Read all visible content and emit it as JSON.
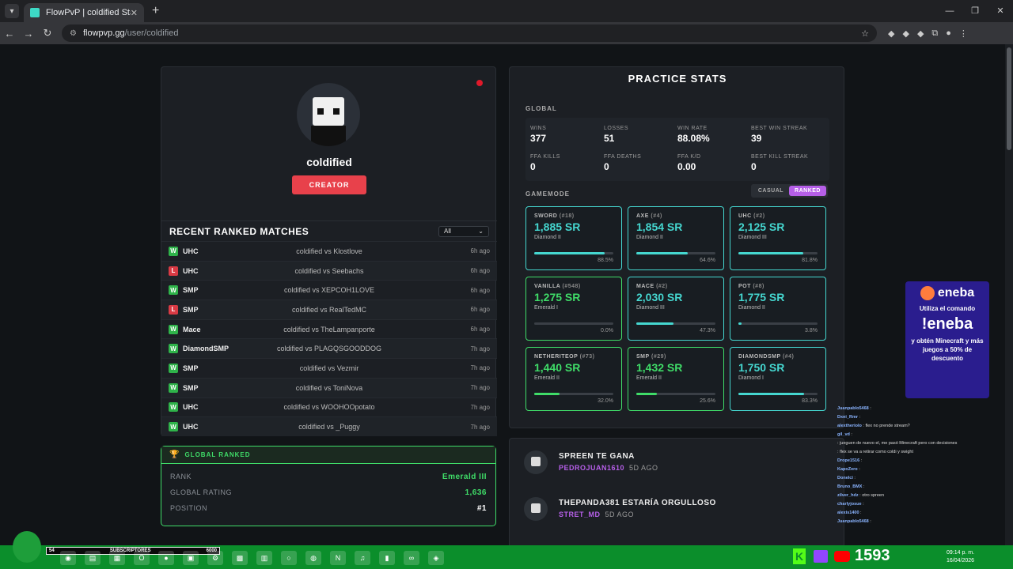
{
  "browser": {
    "tab_title": "FlowPvP | coldified Stats",
    "url_host": "flowpvp.gg",
    "url_path": "/user/coldified"
  },
  "profile": {
    "username": "coldified",
    "role_badge": "CREATOR"
  },
  "recent_matches": {
    "title": "RECENT RANKED MATCHES",
    "filter": "All",
    "rows": [
      {
        "result": "W",
        "mode": "UHC",
        "match": "coldified vs Klostlove",
        "time": "6h ago"
      },
      {
        "result": "L",
        "mode": "UHC",
        "match": "coldified vs Seebachs",
        "time": "6h ago"
      },
      {
        "result": "W",
        "mode": "SMP",
        "match": "coldified vs XEPCOH1LOVE",
        "time": "6h ago"
      },
      {
        "result": "L",
        "mode": "SMP",
        "match": "coldified vs RealTedMC",
        "time": "6h ago"
      },
      {
        "result": "W",
        "mode": "Mace",
        "match": "coldified vs TheLampanporte",
        "time": "6h ago"
      },
      {
        "result": "W",
        "mode": "DiamondSMP",
        "match": "coldified vs PLAGQSGOODDOG",
        "time": "7h ago"
      },
      {
        "result": "W",
        "mode": "SMP",
        "match": "coldified vs Vezmir",
        "time": "7h ago"
      },
      {
        "result": "W",
        "mode": "SMP",
        "match": "coldified vs ToniNova",
        "time": "7h ago"
      },
      {
        "result": "W",
        "mode": "UHC",
        "match": "coldified vs WOOHOOpotato",
        "time": "7h ago"
      },
      {
        "result": "W",
        "mode": "UHC",
        "match": "coldified vs _Puggy",
        "time": "7h ago"
      }
    ]
  },
  "global_ranked": {
    "title": "GLOBAL RANKED",
    "rank_label": "RANK",
    "rank_value": "Emerald III",
    "rating_label": "GLOBAL RATING",
    "rating_value": "1,636",
    "position_label": "POSITION",
    "position_value": "#1"
  },
  "practice": {
    "title": "PRACTICE STATS",
    "global_label": "GLOBAL",
    "gamemode_label": "GAMEMODE",
    "toggle": {
      "casual": "CASUAL",
      "ranked": "RANKED"
    },
    "global_stats": [
      {
        "label": "WINS",
        "value": "377"
      },
      {
        "label": "LOSSES",
        "value": "51"
      },
      {
        "label": "WIN RATE",
        "value": "88.08%"
      },
      {
        "label": "BEST WIN STREAK",
        "value": "39"
      },
      {
        "label": "FFA KILLS",
        "value": "0"
      },
      {
        "label": "FFA DEATHS",
        "value": "0"
      },
      {
        "label": "FFA K/D",
        "value": "0.00"
      },
      {
        "label": "BEST KILL STREAK",
        "value": "0"
      }
    ],
    "modes": [
      {
        "name": "SWORD",
        "rank": "(#18)",
        "sr": "1,885 SR",
        "tier": "Diamond II",
        "pct": "88.5%",
        "fill": 88.5,
        "color": "cyan"
      },
      {
        "name": "AXE",
        "rank": "(#4)",
        "sr": "1,854 SR",
        "tier": "Diamond II",
        "pct": "64.6%",
        "fill": 64.6,
        "color": "cyan"
      },
      {
        "name": "UHC",
        "rank": "(#2)",
        "sr": "2,125 SR",
        "tier": "Diamond III",
        "pct": "81.8%",
        "fill": 81.8,
        "color": "cyan"
      },
      {
        "name": "VANILLA",
        "rank": "(#548)",
        "sr": "1,275 SR",
        "tier": "Emerald I",
        "pct": "0.0%",
        "fill": 0,
        "color": "green"
      },
      {
        "name": "MACE",
        "rank": "(#2)",
        "sr": "2,030 SR",
        "tier": "Diamond III",
        "pct": "47.3%",
        "fill": 47.3,
        "color": "cyan"
      },
      {
        "name": "POT",
        "rank": "(#8)",
        "sr": "1,775 SR",
        "tier": "Diamond II",
        "pct": "3.8%",
        "fill": 3.8,
        "color": "cyan"
      },
      {
        "name": "NETHERITEOP",
        "rank": "(#73)",
        "sr": "1,440 SR",
        "tier": "Emerald II",
        "pct": "32.0%",
        "fill": 32.0,
        "color": "green"
      },
      {
        "name": "SMP",
        "rank": "(#29)",
        "sr": "1,432 SR",
        "tier": "Emerald II",
        "pct": "25.6%",
        "fill": 25.6,
        "color": "green"
      },
      {
        "name": "DIAMONDSMP",
        "rank": "(#4)",
        "sr": "1,750 SR",
        "tier": "Diamond I",
        "pct": "83.3%",
        "fill": 83.3,
        "color": "cyan"
      }
    ]
  },
  "comments": [
    {
      "text": "SPREEN TE GANA",
      "user": "PEDROJUAN1610",
      "time": "5D AGO"
    },
    {
      "text": "THEPANDA381 ESTARÍA ORGULLOSO",
      "user": "STRET_MD",
      "time": "5D AGO"
    }
  ],
  "eneba": {
    "brand": "eneba",
    "line1": "Utiliza el comando",
    "command": "!eneba",
    "line2": "y obtén Minecraft y más juegos a 50% de descuento"
  },
  "chat": [
    {
      "user": "Juanpablo5468",
      "msg": ""
    },
    {
      "user": "Dxni_Rmr",
      "msg": ""
    },
    {
      "user": "alextheriolo",
      "msg": "flex no prende stream?"
    },
    {
      "user": "gil_vd",
      "msg": ""
    },
    {
      "user": "",
      "msg": "jueguen de nuevo el, me pasó Minecraft pero con decisiones"
    },
    {
      "user": "",
      "msg": "flex se va a retirar como coldi y swight"
    },
    {
      "user": "Drope1516",
      "msg": ""
    },
    {
      "user": "KapoZero",
      "msg": ""
    },
    {
      "user": "Donelci",
      "msg": ""
    },
    {
      "user": "Bruno_BMX",
      "msg": ""
    },
    {
      "user": "zilver_hdz",
      "msg": "otro spreen"
    },
    {
      "user": "charlyjosue",
      "msg": ""
    },
    {
      "user": "alexis1400",
      "msg": ""
    },
    {
      "user": "Juanpablo5468",
      "msg": ""
    }
  ],
  "stream": {
    "subs_label": "SUBSCRIPTORES",
    "subs_left": "54",
    "subs_right": "6000",
    "viewer_count": "1593",
    "time": "09:14 p. m.",
    "date": "16/04/2026"
  }
}
